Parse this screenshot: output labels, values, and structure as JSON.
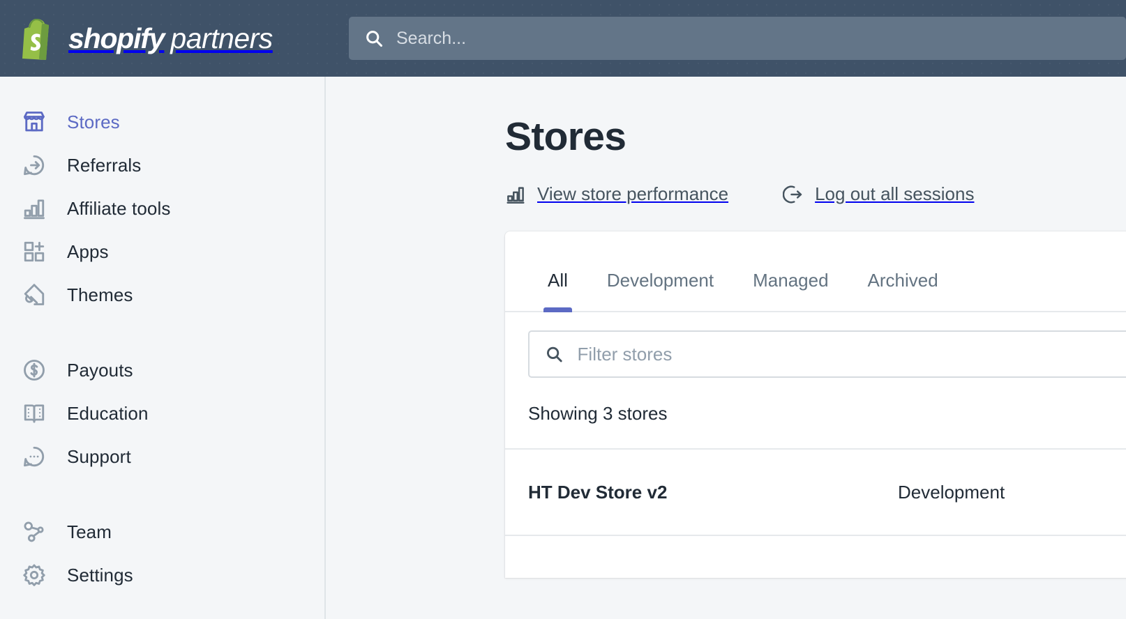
{
  "brand": {
    "logo_icon": "shopify-bag-icon",
    "name_bold": "shopify",
    "name_light": "partners",
    "green": "#95bf47",
    "green_dark": "#5e8e3e",
    "header_bg": "#3f5268",
    "accent": "#5c6ac4"
  },
  "search": {
    "icon": "search-icon",
    "placeholder": "Search...",
    "value": ""
  },
  "sidebar": {
    "items": [
      {
        "label": "Stores",
        "icon": "storefront-icon",
        "active": true
      },
      {
        "label": "Referrals",
        "icon": "chat-arrow-icon",
        "active": false
      },
      {
        "label": "Affiliate tools",
        "icon": "bar-chart-icon",
        "active": false
      },
      {
        "label": "Apps",
        "icon": "apps-plus-icon",
        "active": false
      },
      {
        "label": "Themes",
        "icon": "paintbrush-icon",
        "active": false
      },
      {
        "label": "Payouts",
        "icon": "dollar-circle-icon",
        "active": false
      },
      {
        "label": "Education",
        "icon": "open-book-icon",
        "active": false
      },
      {
        "label": "Support",
        "icon": "chat-dots-icon",
        "active": false
      },
      {
        "label": "Team",
        "icon": "team-nodes-icon",
        "active": false
      },
      {
        "label": "Settings",
        "icon": "gear-icon",
        "active": false
      }
    ]
  },
  "page": {
    "title": "Stores",
    "actions": [
      {
        "label": "View store performance",
        "icon": "bar-chart-icon"
      },
      {
        "label": "Log out all sessions",
        "icon": "logout-icon"
      }
    ]
  },
  "stores_card": {
    "tabs": [
      {
        "label": "All",
        "active": true
      },
      {
        "label": "Development",
        "active": false
      },
      {
        "label": "Managed",
        "active": false
      },
      {
        "label": "Archived",
        "active": false
      }
    ],
    "filter": {
      "icon": "search-icon",
      "placeholder": "Filter stores",
      "value": ""
    },
    "showing_text": "Showing 3 stores",
    "rows": [
      {
        "name": "HT Dev Store v2",
        "type": "Development"
      }
    ]
  }
}
